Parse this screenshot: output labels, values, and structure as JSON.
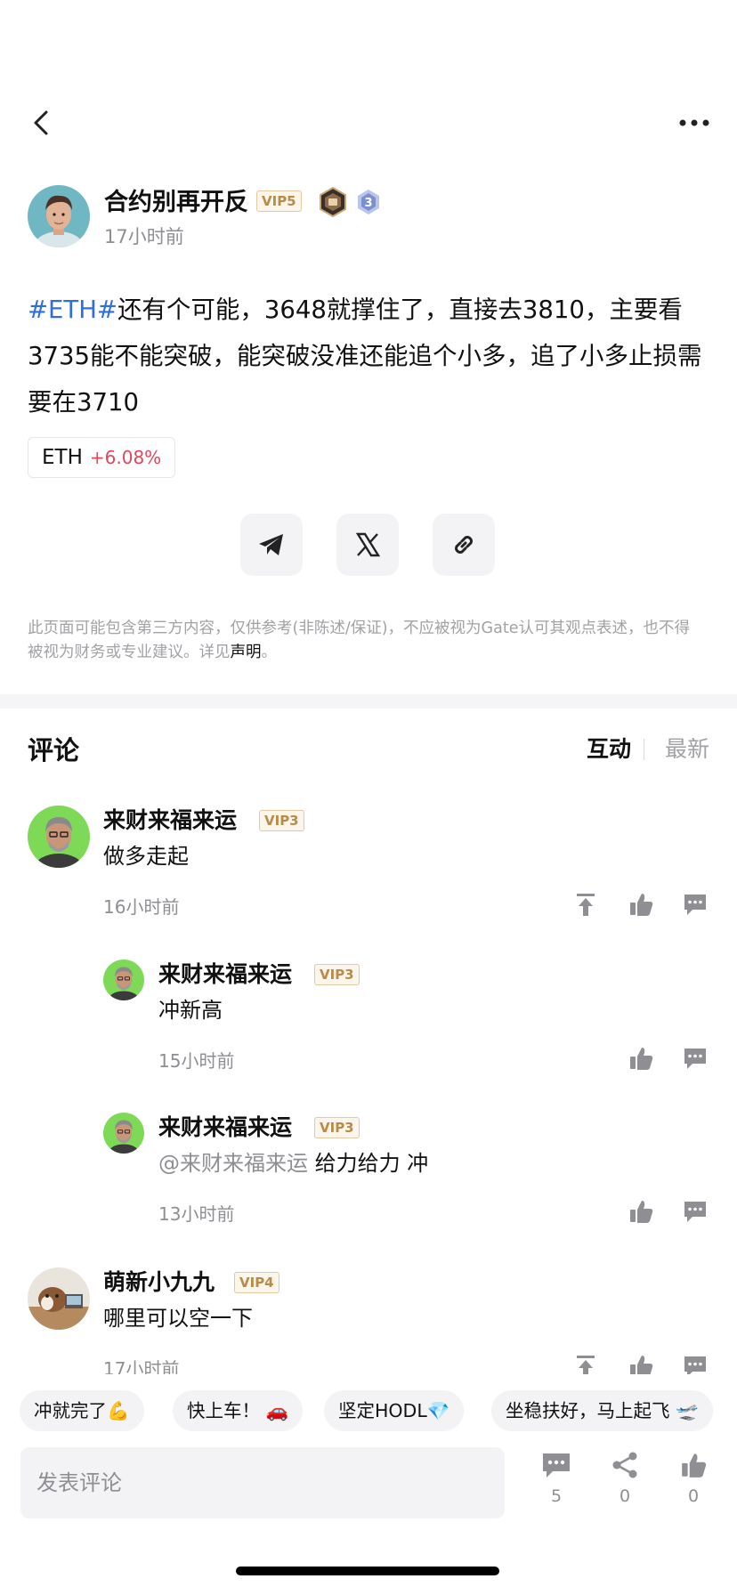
{
  "post": {
    "author_name": "合约别再开反",
    "author_vip": "VIP5",
    "author_level": "3",
    "time": "17小时前",
    "hashtag": "#ETH#",
    "body": "还有个可能，3648就撑住了，直接去3810，主要看3735能不能突破，能突破没准还能追个小多，追了小多止损需要在3710",
    "coin": {
      "symbol": "ETH",
      "change": "+6.08%"
    },
    "disclaimer_text": "此页面可能包含第三方内容，仅供参考(非陈述/保证)，不应被视为Gate认可其观点表述，也不得被视为财务或专业建议。详见",
    "disclaimer_link": "声明",
    "disclaimer_end": "。"
  },
  "share": {
    "telegram_icon": "telegram-icon",
    "x_icon": "x-icon",
    "link_icon": "link-icon"
  },
  "comments_section": {
    "title": "评论",
    "sort_active": "互动",
    "sort_inactive": "最新",
    "items": [
      {
        "name": "来财来福来运",
        "vip": "VIP3",
        "text": "做多走起",
        "time": "16小时前"
      },
      {
        "name": "来财来福来运",
        "vip": "VIP3",
        "text": "冲新高",
        "time": "15小时前"
      },
      {
        "name": "来财来福来运",
        "vip": "VIP3",
        "mention": "@来财来福来运",
        "text": "给力给力 冲",
        "time": "13小时前"
      },
      {
        "name": "萌新小九九",
        "vip": "VIP4",
        "text": "哪里可以空一下",
        "time": "17小时前"
      }
    ]
  },
  "quick_replies": [
    "冲就完了💪",
    "快上车！ 🚗",
    "坚定HODL💎",
    "坐稳扶好，马上起飞 🛫"
  ],
  "bottom": {
    "input_placeholder": "发表评论",
    "comment_count": "5",
    "share_count": "0",
    "like_count": "0"
  },
  "colors": {
    "hashtag": "#2f6de1",
    "change_positive": "#e0475b",
    "vip_text": "#b88b4a",
    "muted": "#8e8e93"
  }
}
